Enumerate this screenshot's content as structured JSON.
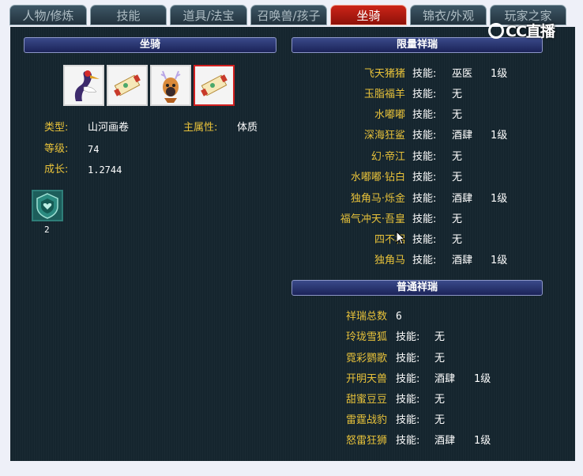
{
  "tabs": [
    {
      "label": "人物/修炼",
      "active": false
    },
    {
      "label": "技能",
      "active": false
    },
    {
      "label": "道具/法宝",
      "active": false
    },
    {
      "label": "召唤兽/孩子",
      "active": false
    },
    {
      "label": "坐骑",
      "active": true
    },
    {
      "label": "锦衣/外观",
      "active": false
    },
    {
      "label": "玩家之家",
      "active": false
    }
  ],
  "watermark": "CC直播",
  "left": {
    "header": "坐骑",
    "slots": [
      {
        "icon": "crane-mount-icon",
        "selected": false
      },
      {
        "icon": "scroll-icon",
        "selected": false
      },
      {
        "icon": "deer-mount-icon",
        "selected": false
      },
      {
        "icon": "scroll-icon",
        "selected": true
      }
    ],
    "type_label": "类型:",
    "type_value": "山河画卷",
    "attr_label": "主属性:",
    "attr_value": "体质",
    "level_label": "等级:",
    "level_value": "74",
    "growth_label": "成长:",
    "growth_value": "1.2744",
    "item_icon": "shield-heart-icon",
    "item_count": "2"
  },
  "limited": {
    "header": "限量祥瑞",
    "rows": [
      {
        "name": "飞天猪猪",
        "skill_label": "技能:",
        "skill": "巫医",
        "level": "1级"
      },
      {
        "name": "玉脂福羊",
        "skill_label": "技能:",
        "skill": "无",
        "level": ""
      },
      {
        "name": "水嘟嘟",
        "skill_label": "技能:",
        "skill": "无",
        "level": ""
      },
      {
        "name": "深海狂鲨",
        "skill_label": "技能:",
        "skill": "酒肆",
        "level": "1级"
      },
      {
        "name": "幻·帝江",
        "skill_label": "技能:",
        "skill": "无",
        "level": ""
      },
      {
        "name": "水嘟嘟·钻白",
        "skill_label": "技能:",
        "skill": "无",
        "level": ""
      },
      {
        "name": "独角马·烁金",
        "skill_label": "技能:",
        "skill": "酒肆",
        "level": "1级"
      },
      {
        "name": "福气冲天·吾皇",
        "skill_label": "技能:",
        "skill": "无",
        "level": ""
      },
      {
        "name": "四不相",
        "skill_label": "技能:",
        "skill": "无",
        "level": ""
      },
      {
        "name": "独角马",
        "skill_label": "技能:",
        "skill": "酒肆",
        "level": "1级"
      }
    ]
  },
  "common": {
    "header": "普通祥瑞",
    "total_label": "祥瑞总数",
    "total": "6",
    "rows": [
      {
        "name": "玲珑雪狐",
        "skill_label": "技能:",
        "skill": "无",
        "level": ""
      },
      {
        "name": "霓彩鹦歌",
        "skill_label": "技能:",
        "skill": "无",
        "level": ""
      },
      {
        "name": "开明天兽",
        "skill_label": "技能:",
        "skill": "酒肆",
        "level": "1级"
      },
      {
        "name": "甜蜜豆豆",
        "skill_label": "技能:",
        "skill": "无",
        "level": ""
      },
      {
        "name": "雷霆战豹",
        "skill_label": "技能:",
        "skill": "无",
        "level": ""
      },
      {
        "name": "怒雷狂狮",
        "skill_label": "技能:",
        "skill": "酒肆",
        "level": "1级"
      }
    ]
  }
}
